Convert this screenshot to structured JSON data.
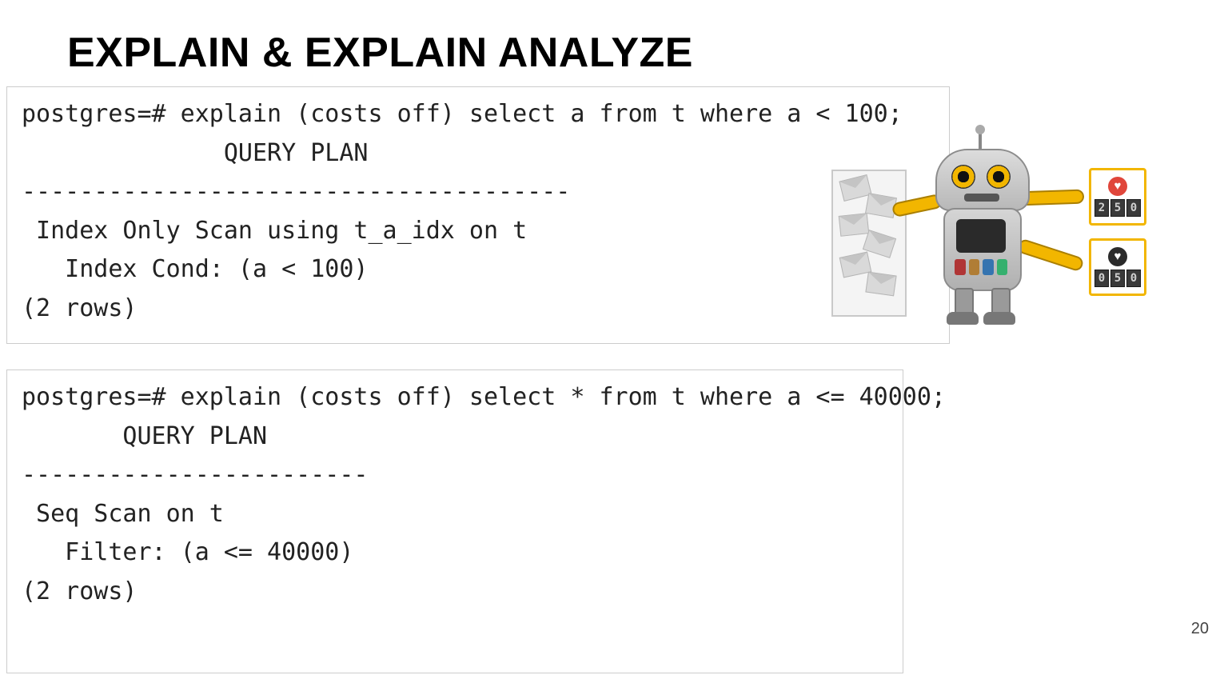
{
  "title": "EXPLAIN  &  EXPLAIN ANALYZE",
  "page_number": "20",
  "terminal": {
    "top": "postgres=# explain (costs off) select a from t where a < 100;\n              QUERY PLAN\n--------------------------------------\n Index Only Scan using t_a_idx on t\n   Index Cond: (a < 100)\n(2 rows)",
    "bottom": "postgres=# explain (costs off) select * from t where a <= 40000;\n       QUERY PLAN\n------------------------\n Seq Scan on t\n   Filter: (a <= 40000)\n(2 rows)"
  },
  "robot": {
    "score_top": "250",
    "score_bottom": "050"
  }
}
